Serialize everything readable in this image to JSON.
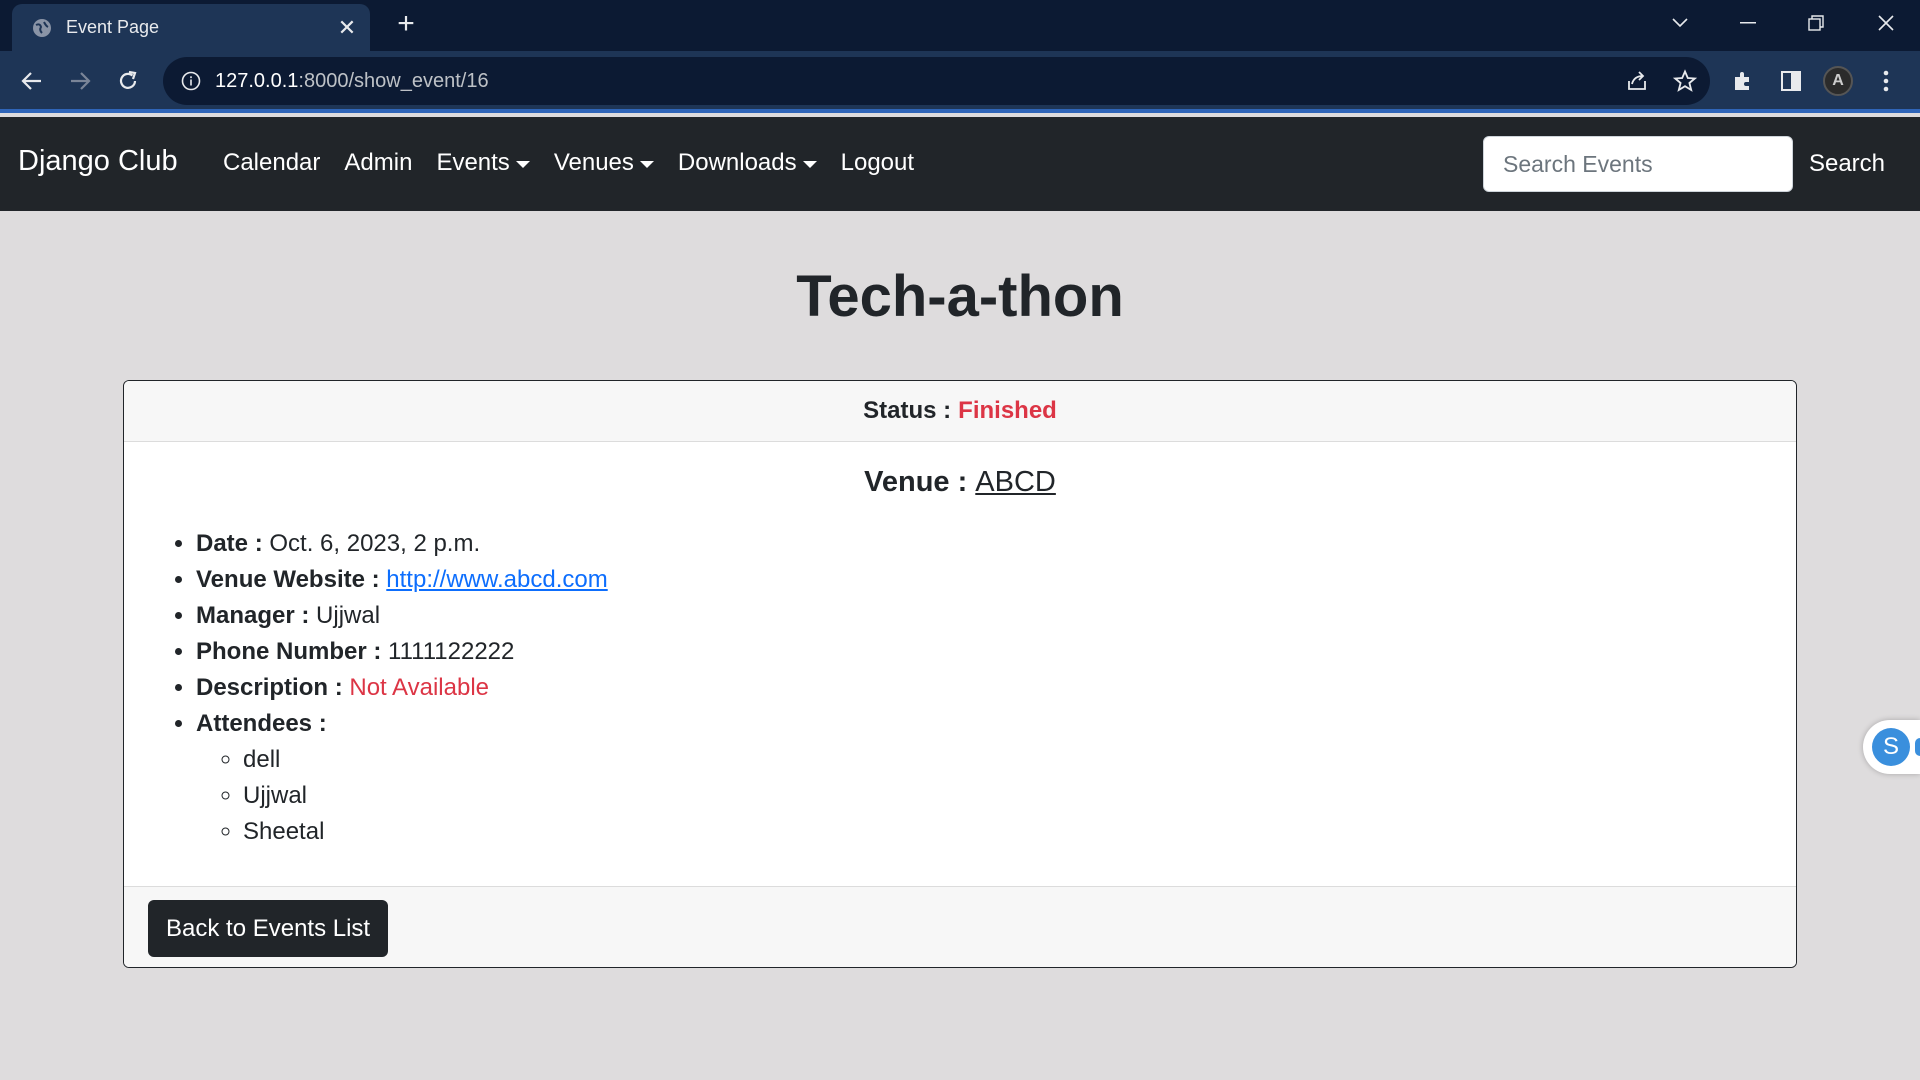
{
  "browser": {
    "tab_title": "Event Page",
    "url_host": "127.0.0.1",
    "url_path": ":8000/show_event/16",
    "icons": [
      "globe-icon",
      "close-icon",
      "plus-icon",
      "chevron-down-icon",
      "minimize-icon",
      "restore-icon",
      "window-close-icon",
      "back-arrow-icon",
      "forward-arrow-icon",
      "reload-icon",
      "info-icon",
      "share-icon",
      "star-icon",
      "puzzle-icon",
      "sidebar-icon",
      "profile-avatar-icon",
      "kebab-menu-icon"
    ]
  },
  "navbar": {
    "brand": "Django Club",
    "links": [
      "Calendar",
      "Admin",
      "Events",
      "Venues",
      "Downloads",
      "Logout"
    ],
    "search_placeholder": "Search Events",
    "search_button": "Search"
  },
  "event": {
    "title": "Tech-a-thon",
    "status_label": "Status :",
    "status_value": "Finished",
    "venue_label": "Venue :",
    "venue_name": "ABCD",
    "date_label": "Date :",
    "date_value": "Oct. 6, 2023, 2 p.m.",
    "website_label": "Venue Website :",
    "website_value": "http://www.abcd.com",
    "manager_label": "Manager :",
    "manager_value": "Ujjwal",
    "phone_label": "Phone Number :",
    "phone_value": "1111122222",
    "description_label": "Description :",
    "description_value": "Not Available",
    "attendees_label": "Attendees :",
    "attendees": [
      "dell",
      "Ujjwal",
      "Sheetal"
    ],
    "back_button": "Back to Events List"
  },
  "side_widget": {
    "letter": "S"
  },
  "colors": {
    "navbar_bg": "#212529",
    "page_bg": "#dedcdd",
    "danger": "#dc3545",
    "link": "#0d6efd",
    "chrome_tab": "#1e3556",
    "chrome_bar": "#0c1a33"
  }
}
